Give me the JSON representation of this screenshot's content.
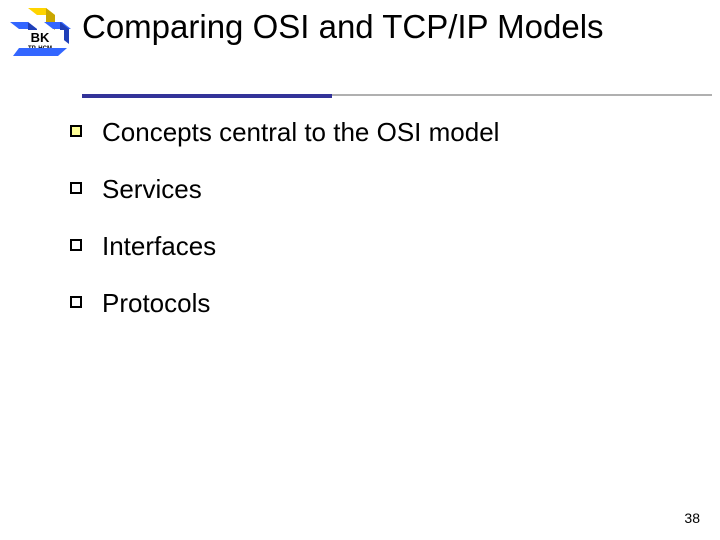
{
  "logo": {
    "text_top": "BK",
    "text_bottom": "TP. HCM"
  },
  "title": "Comparing OSI and TCP/IP Models",
  "bullets": [
    "Concepts central to the OSI model",
    "Services",
    "Interfaces",
    "Protocols"
  ],
  "page_number": "38"
}
